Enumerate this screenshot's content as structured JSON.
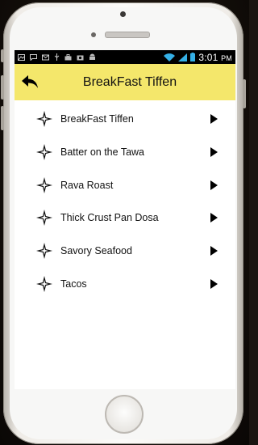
{
  "status_bar": {
    "time": "3:01",
    "ampm": "PM",
    "left_icons": [
      "image-icon",
      "chat-icon",
      "mail-icon",
      "usb-icon",
      "bag-icon",
      "camera-icon",
      "android-icon"
    ],
    "right_icons": [
      "wifi-icon",
      "signal-icon",
      "battery-icon"
    ]
  },
  "app_bar": {
    "title": "BreakFast Tiffen",
    "back_icon": "back-arrow-icon",
    "color": "#f4e76b"
  },
  "menu": {
    "items": [
      {
        "label": "BreakFast Tiffen"
      },
      {
        "label": "Batter on the Tawa"
      },
      {
        "label": "Rava Roast"
      },
      {
        "label": "Thick Crust Pan Dosa"
      },
      {
        "label": "Savory Seafood"
      },
      {
        "label": "Tacos"
      }
    ],
    "item_icon": "four-point-star-icon",
    "trailing_icon": "chevron-right-icon"
  }
}
